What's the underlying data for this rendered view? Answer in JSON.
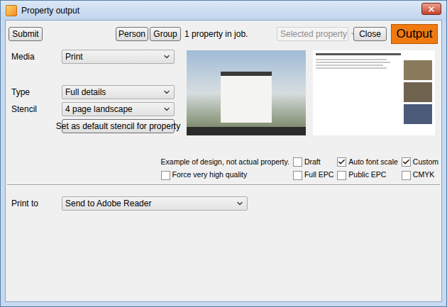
{
  "window": {
    "title": "Property output"
  },
  "toolbar": {
    "submit": "Submit",
    "person": "Person",
    "group": "Group",
    "job_count": "1 property in job.",
    "scope": {
      "value": "Selected property",
      "disabled": true
    },
    "close": "Close",
    "output": "Output"
  },
  "form": {
    "media": {
      "label": "Media",
      "value": "Print"
    },
    "type": {
      "label": "Type",
      "value": "Full details"
    },
    "stencil": {
      "label": "Stencil",
      "value": "4 page landscape"
    },
    "default_stencil_button": "Set as default stencil for property"
  },
  "preview": {
    "note": "Example of design, not actual property."
  },
  "options": [
    {
      "label": "Draft",
      "checked": false
    },
    {
      "label": "Auto font scale",
      "checked": true
    },
    {
      "label": "Custom",
      "checked": true
    },
    {
      "label": "Force very high quality",
      "checked": false
    },
    {
      "label": "Full EPC",
      "checked": false
    },
    {
      "label": "Public EPC",
      "checked": false
    },
    {
      "label": "CMYK",
      "checked": false
    }
  ],
  "print_to": {
    "label": "Print to",
    "value": "Send to Adobe Reader"
  }
}
